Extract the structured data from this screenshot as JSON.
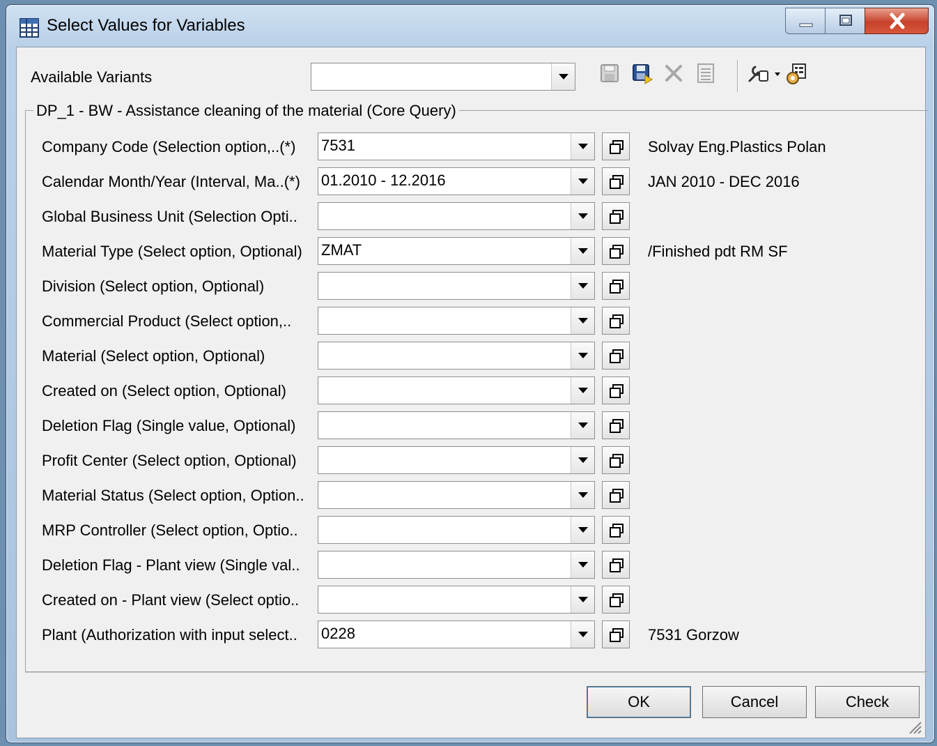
{
  "window": {
    "title": "Select Values for Variables"
  },
  "toolbar": {
    "variants_label": "Available Variants",
    "variants_value": "",
    "icons": [
      "save-icon",
      "save-as-icon",
      "delete-icon",
      "details-icon",
      "tools-icon",
      "personalize-icon"
    ]
  },
  "group": {
    "caption": "DP_1 - BW - Assistance cleaning of the material (Core Query)"
  },
  "rows": [
    {
      "label": "Company Code (Selection option,..(*)",
      "value": "7531",
      "desc": "Solvay Eng.Plastics Polan"
    },
    {
      "label": "Calendar Month/Year (Interval, Ma..(*)",
      "value": "01.2010 - 12.2016",
      "desc": "JAN 2010 - DEC 2016"
    },
    {
      "label": "Global Business Unit (Selection Opti..",
      "value": "",
      "desc": ""
    },
    {
      "label": "Material Type (Select option, Optional)",
      "value": "ZMAT",
      "desc": "/Finished pdt  RM  SF"
    },
    {
      "label": "Division (Select option, Optional)",
      "value": "",
      "desc": ""
    },
    {
      "label": "Commercial Product (Select option,..",
      "value": "",
      "desc": ""
    },
    {
      "label": "Material (Select option, Optional)",
      "value": "",
      "desc": ""
    },
    {
      "label": "Created on (Select option, Optional)",
      "value": "",
      "desc": ""
    },
    {
      "label": "Deletion Flag (Single value, Optional)",
      "value": "",
      "desc": ""
    },
    {
      "label": "Profit Center (Select option, Optional)",
      "value": "",
      "desc": ""
    },
    {
      "label": "Material Status (Select option, Option..",
      "value": "",
      "desc": ""
    },
    {
      "label": "MRP Controller (Select option, Optio..",
      "value": "",
      "desc": ""
    },
    {
      "label": "Deletion Flag - Plant view (Single val..",
      "value": "",
      "desc": ""
    },
    {
      "label": "Created on - Plant view (Select optio..",
      "value": "",
      "desc": ""
    },
    {
      "label": "Plant (Authorization with input select..",
      "value": "0228",
      "desc": "7531 Gorzow"
    }
  ],
  "buttons": {
    "ok": "OK",
    "cancel": "Cancel",
    "check": "Check"
  }
}
